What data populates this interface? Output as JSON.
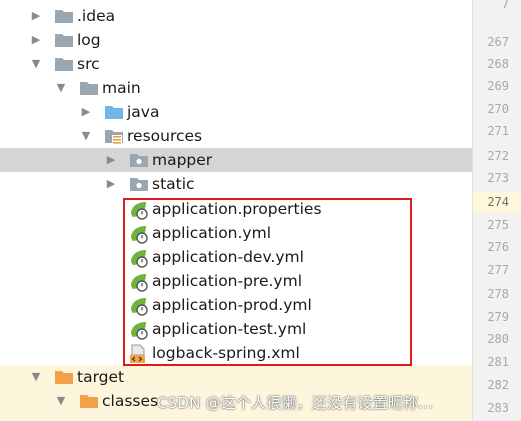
{
  "tree": {
    "items": [
      {
        "label": ".idea",
        "icon": "folder-gray-icon",
        "expanded": false
      },
      {
        "label": "log",
        "icon": "folder-gray-icon",
        "expanded": false
      },
      {
        "label": "src",
        "icon": "folder-gray-icon",
        "expanded": true
      },
      {
        "label": "main",
        "icon": "folder-gray-icon",
        "expanded": true
      },
      {
        "label": "java",
        "icon": "folder-blue-source-icon",
        "expanded": false
      },
      {
        "label": "resources",
        "icon": "folder-resources-icon",
        "expanded": true
      },
      {
        "label": "mapper",
        "icon": "folder-package-icon",
        "expanded": false,
        "selected": true
      },
      {
        "label": "static",
        "icon": "folder-package-icon",
        "expanded": false
      },
      {
        "label": "application.properties",
        "icon": "spring-config-icon"
      },
      {
        "label": "application.yml",
        "icon": "spring-config-icon"
      },
      {
        "label": "application-dev.yml",
        "icon": "spring-config-icon"
      },
      {
        "label": "application-pre.yml",
        "icon": "spring-config-icon"
      },
      {
        "label": "application-prod.yml",
        "icon": "spring-config-icon"
      },
      {
        "label": "application-test.yml",
        "icon": "spring-config-icon"
      },
      {
        "label": "logback-spring.xml",
        "icon": "xml-file-icon"
      },
      {
        "label": "target",
        "icon": "folder-orange-icon",
        "expanded": true
      },
      {
        "label": "classes",
        "icon": "folder-orange-icon",
        "expanded": true
      }
    ]
  },
  "gutter": {
    "top_partial": "7",
    "lines": [
      "267",
      "268",
      "269",
      "270",
      "271",
      "272",
      "273",
      "274",
      "275",
      "276",
      "277",
      "278",
      "279",
      "280",
      "281",
      "282",
      "283"
    ],
    "current": "274"
  },
  "watermark": "CSDN @这个人很懒，还没有设置昵称...",
  "colors": {
    "selected_row": "#d5d5d5",
    "excluded_row": "#fdf6dd",
    "highlight_border": "#e0191b",
    "spring_green": "#6db33f",
    "folder_gray": "#9aa7b0",
    "folder_blue": "#6fb5e6",
    "folder_orange": "#f4a14a"
  }
}
